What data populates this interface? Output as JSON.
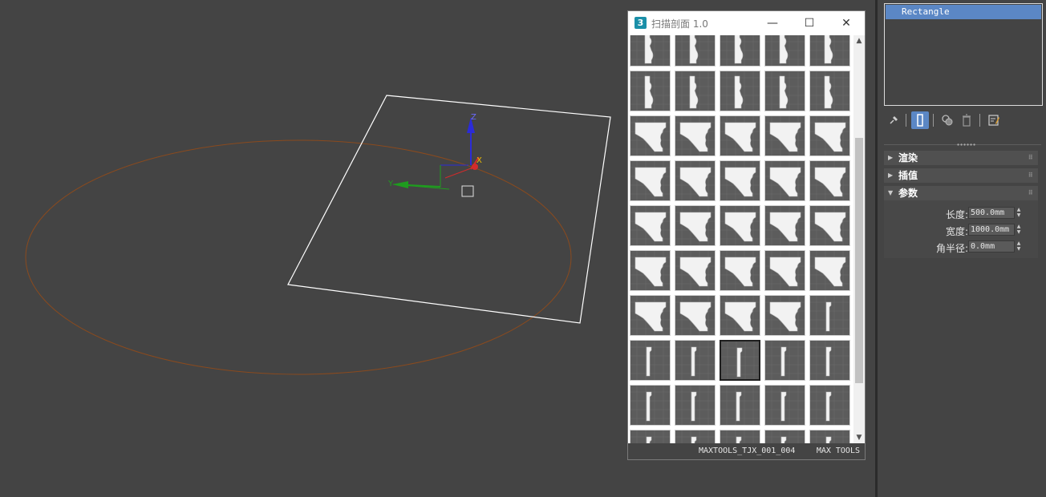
{
  "colors": {
    "viewport_bg": "#444444",
    "ellipse_stroke": "#8a4a1e",
    "rectangle_stroke": "#ffffff",
    "axis_x": "#d22b2b",
    "axis_y": "#1f9c1f",
    "axis_z": "#2b2bd8",
    "selection_highlight": "#5b87c5"
  },
  "viewport": {
    "gizmo_axis_x_label": "X",
    "gizmo_axis_y_label": "Y",
    "gizmo_axis_z_label": "Z"
  },
  "profile_window": {
    "title": "扫描剖面 1.0",
    "app_icon_text": "3",
    "minimize_icon": "—",
    "maximize_icon": "☐",
    "close_icon": "✕",
    "scroll_up_icon": "▲",
    "scroll_down_icon": "▼",
    "status_filename": "MAXTOOLS_TJX_001_004",
    "status_brand": "MAX TOOLS",
    "thumbnails": [
      {
        "shape": "tall"
      },
      {
        "shape": "tall"
      },
      {
        "shape": "tall"
      },
      {
        "shape": "tall"
      },
      {
        "shape": "tall"
      },
      {
        "shape": "tall"
      },
      {
        "shape": "tall"
      },
      {
        "shape": "tall"
      },
      {
        "shape": "tall"
      },
      {
        "shape": "tall"
      },
      {
        "shape": "cornice"
      },
      {
        "shape": "cornice"
      },
      {
        "shape": "cornice"
      },
      {
        "shape": "cornice"
      },
      {
        "shape": "cornice"
      },
      {
        "shape": "cornice"
      },
      {
        "shape": "cornice"
      },
      {
        "shape": "cornice"
      },
      {
        "shape": "cornice"
      },
      {
        "shape": "cornice"
      },
      {
        "shape": "cornice"
      },
      {
        "shape": "cornice"
      },
      {
        "shape": "cornice"
      },
      {
        "shape": "cornice"
      },
      {
        "shape": "cornice"
      },
      {
        "shape": "cornice"
      },
      {
        "shape": "cornice"
      },
      {
        "shape": "cornice"
      },
      {
        "shape": "cornice"
      },
      {
        "shape": "cornice"
      },
      {
        "shape": "cornice"
      },
      {
        "shape": "cornice"
      },
      {
        "shape": "cornice"
      },
      {
        "shape": "cornice"
      },
      {
        "shape": "bar"
      },
      {
        "shape": "bar"
      },
      {
        "shape": "bar"
      },
      {
        "shape": "bar",
        "selected": true
      },
      {
        "shape": "bar"
      },
      {
        "shape": "bar"
      },
      {
        "shape": "bar"
      },
      {
        "shape": "bar"
      },
      {
        "shape": "bar"
      },
      {
        "shape": "bar"
      },
      {
        "shape": "bar"
      },
      {
        "shape": "bar"
      },
      {
        "shape": "bar"
      },
      {
        "shape": "bar"
      },
      {
        "shape": "bar"
      },
      {
        "shape": "bar"
      }
    ]
  },
  "command_panel": {
    "stack_selected_item": "Rectangle",
    "toolbar_icons": [
      "pin-icon",
      "show-end-result-icon",
      "make-unique-icon",
      "remove-modifier-icon",
      "configure-sets-icon"
    ],
    "rollouts": {
      "render": "渲染",
      "interpolation": "插值",
      "parameters": "参数"
    },
    "params": {
      "length_label": "长度:",
      "length_value": "500.0mm",
      "width_label": "宽度:",
      "width_value": "1000.0mm",
      "corner_radius_label": "角半径:",
      "corner_radius_value": "0.0mm"
    }
  }
}
